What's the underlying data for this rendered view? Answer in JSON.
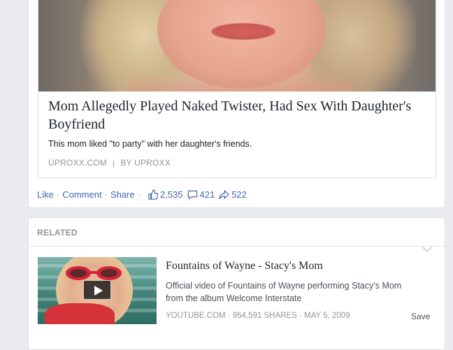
{
  "post": {
    "headline": "Mom Allegedly Played Naked Twister, Had Sex With Daughter's Boyfriend",
    "description": "This mom liked \"to party\" with her daughter's friends.",
    "source_domain": "UPROXX.COM",
    "source_separator": "|",
    "source_author": "BY UPROXX"
  },
  "actions": {
    "like_label": "Like",
    "comment_label": "Comment",
    "share_label": "Share",
    "dot": "·",
    "likes_count": "2,535",
    "comments_count": "421",
    "shares_count": "522"
  },
  "related": {
    "label": "RELATED",
    "item": {
      "title": "Fountains of Wayne - Stacy's Mom",
      "description": "Official video of Fountains of Wayne performing Stacy's Mom from the album Welcome Interstate",
      "meta": "YOUTUBE.COM · 954,591 SHARES · MAY 5, 2009",
      "save_label": "Save"
    }
  },
  "colors": {
    "link": "#4267b2",
    "text": "#1d2129",
    "muted": "#90949c",
    "background": "#e9ebee"
  },
  "icons": [
    "thumbs-up-icon",
    "comment-icon",
    "share-arrow-icon",
    "chevron-down-icon",
    "play-icon"
  ]
}
